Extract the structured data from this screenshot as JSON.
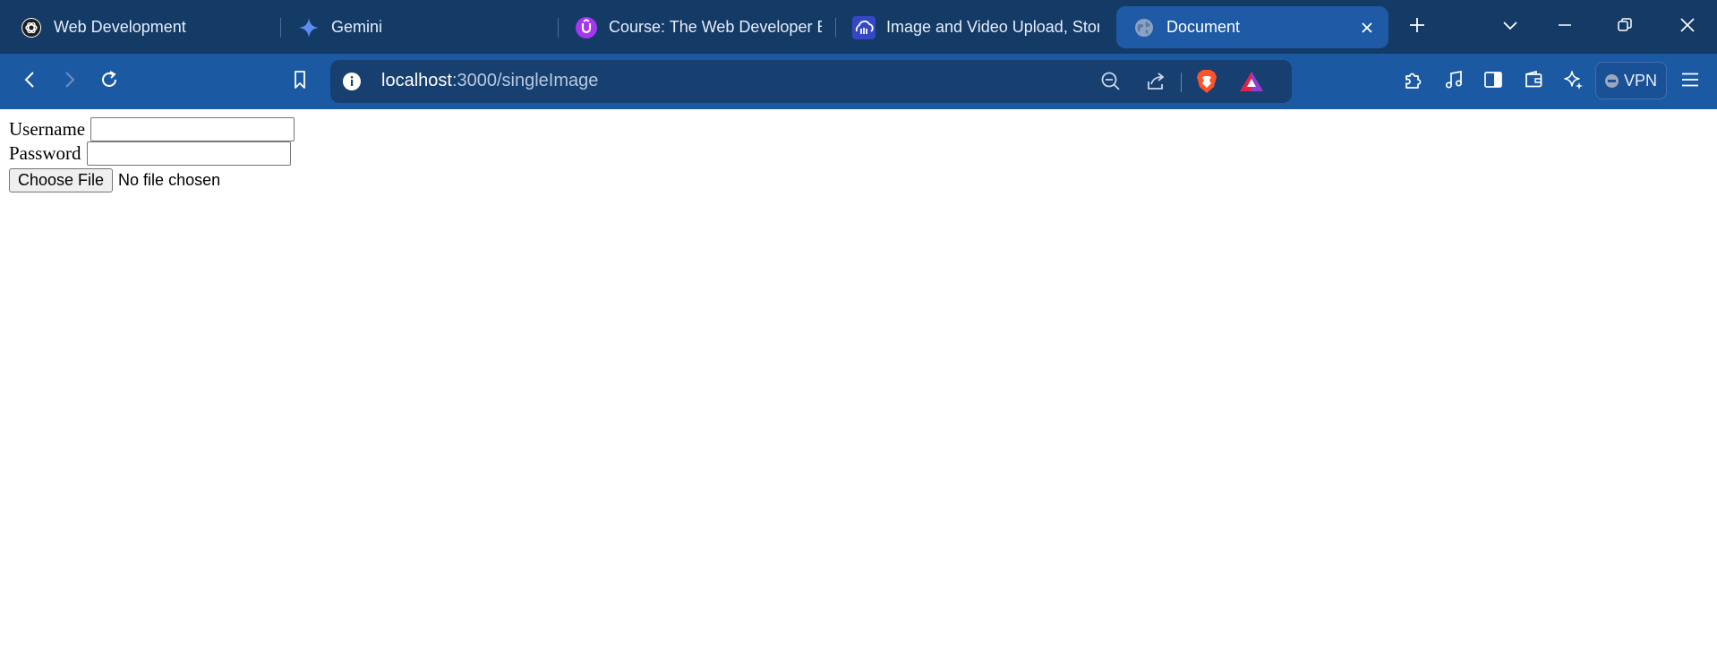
{
  "browser": {
    "tabs": [
      {
        "title": "Web Development",
        "icon": "chatgpt-icon"
      },
      {
        "title": "Gemini",
        "icon": "gemini-sparkle-icon"
      },
      {
        "title": "Course: The Web Developer B",
        "icon": "udemy-icon"
      },
      {
        "title": "Image and Video Upload, Stor",
        "icon": "cloudinary-icon"
      },
      {
        "title": "Document",
        "icon": "globe-icon",
        "active": true
      }
    ],
    "address_bar": {
      "host": "localhost",
      "path": ":3000/singleImage"
    },
    "vpn_label": "VPN"
  },
  "page": {
    "username_label": "Username",
    "username_value": "",
    "password_label": "Password",
    "password_value": "",
    "choose_file_label": "Choose File",
    "file_status": "No file chosen"
  },
  "colors": {
    "tabstrip": "#143a66",
    "toolbar": "#1b5aa3",
    "active_tab": "#1e5aa5",
    "omnibox": "#173f6f"
  }
}
